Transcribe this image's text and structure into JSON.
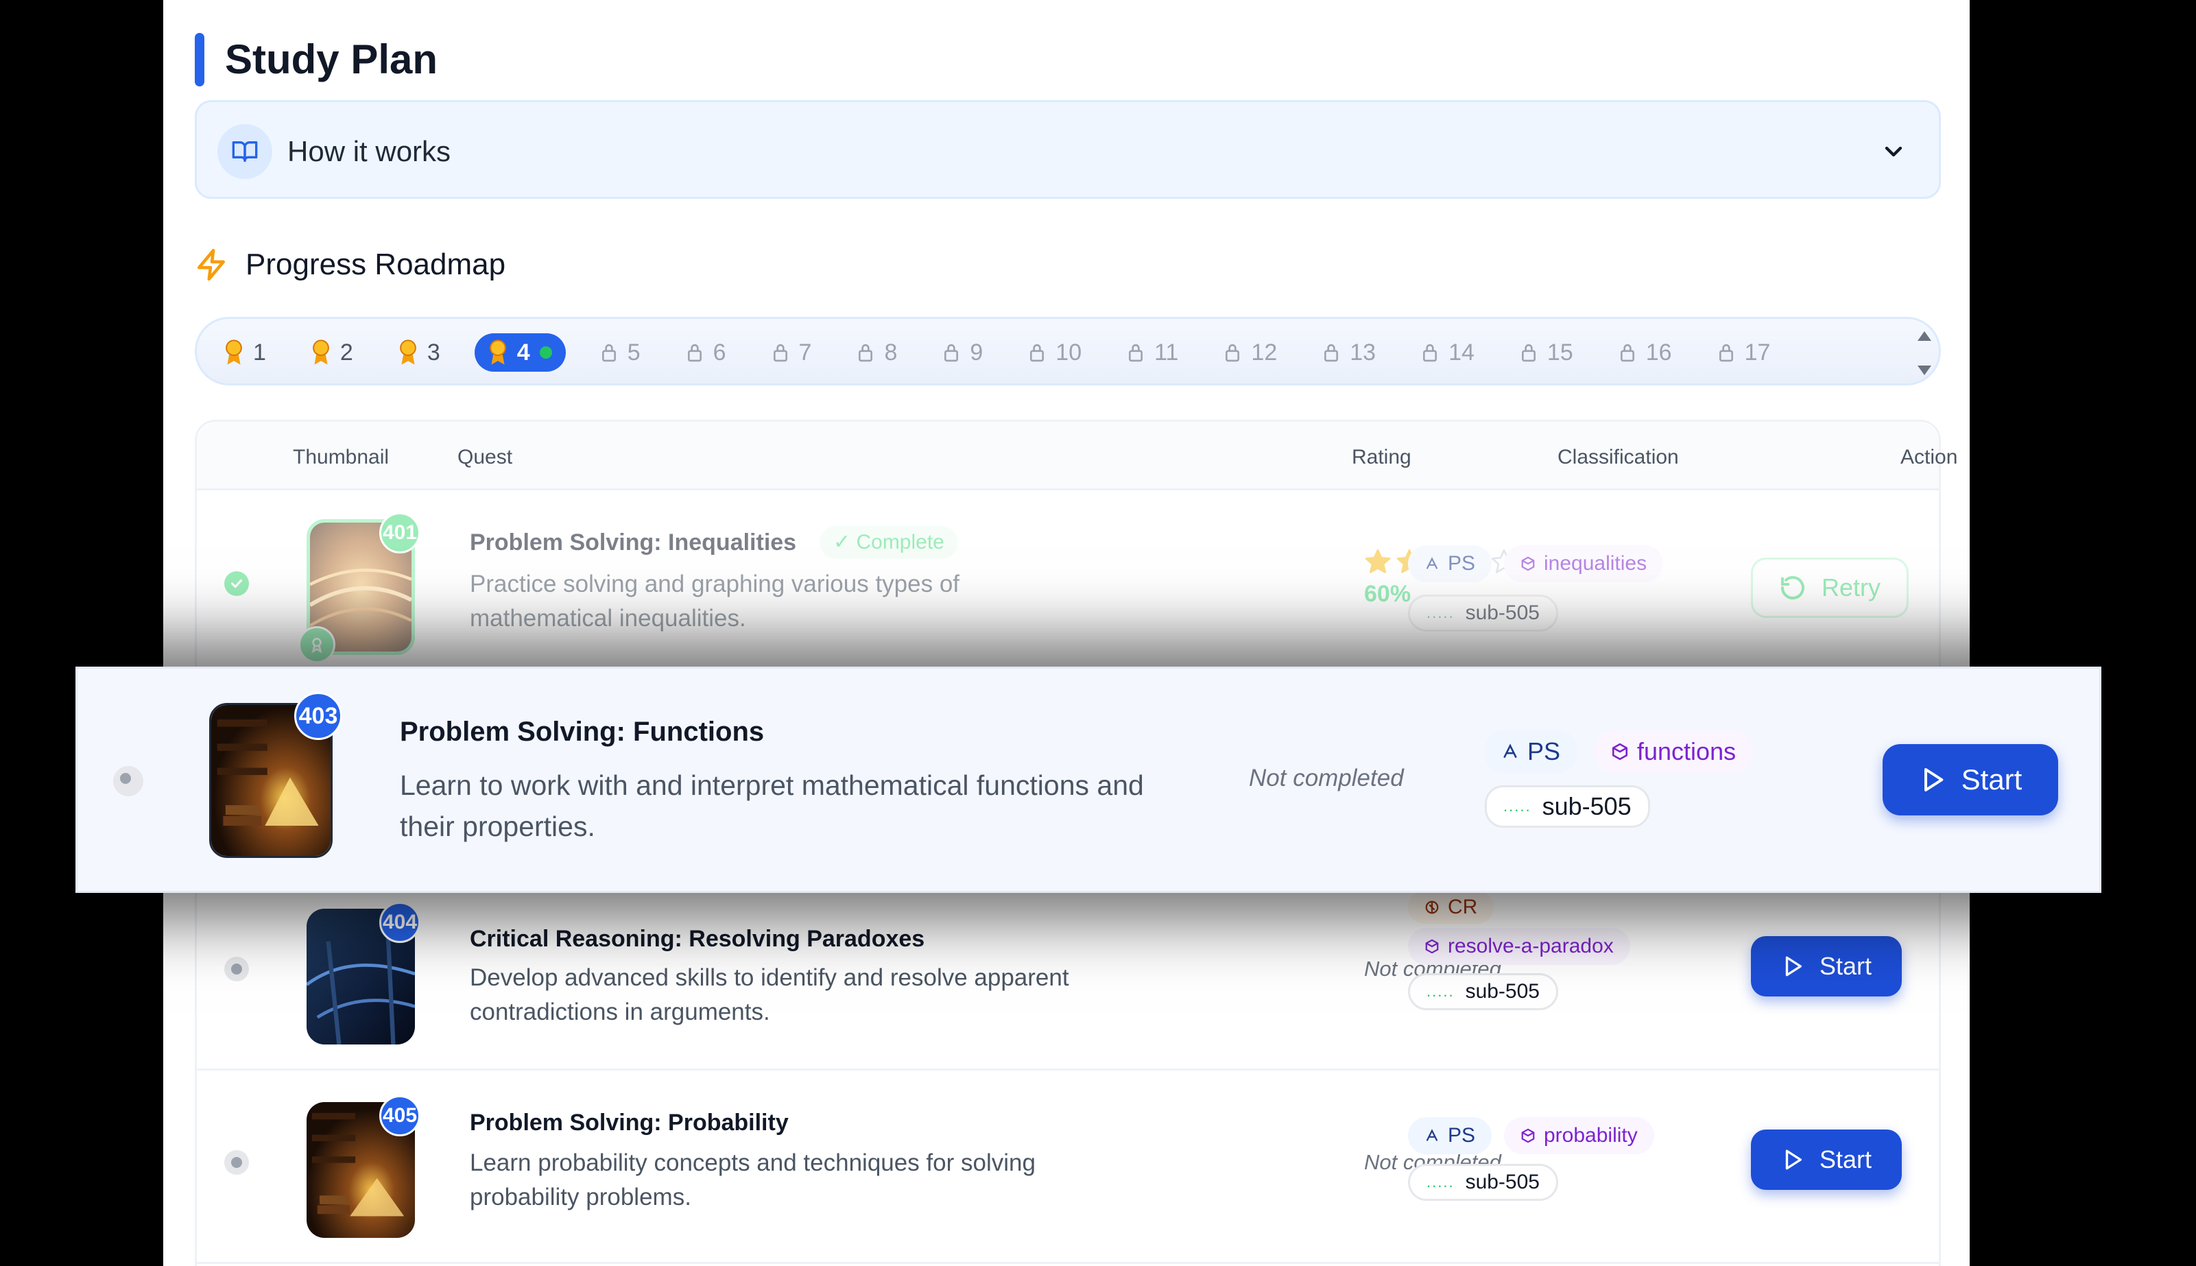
{
  "page": {
    "title": "Study Plan"
  },
  "how_it_works": {
    "label": "How it works",
    "icon": "book-open-icon"
  },
  "roadmap": {
    "heading": "Progress Roadmap",
    "steps": [
      {
        "label": "1",
        "state": "completed"
      },
      {
        "label": "2",
        "state": "completed"
      },
      {
        "label": "3",
        "state": "completed"
      },
      {
        "label": "4",
        "state": "current"
      },
      {
        "label": "5",
        "state": "locked"
      },
      {
        "label": "6",
        "state": "locked"
      },
      {
        "label": "7",
        "state": "locked"
      },
      {
        "label": "8",
        "state": "locked"
      },
      {
        "label": "9",
        "state": "locked"
      },
      {
        "label": "10",
        "state": "locked"
      },
      {
        "label": "11",
        "state": "locked"
      },
      {
        "label": "12",
        "state": "locked"
      },
      {
        "label": "13",
        "state": "locked"
      },
      {
        "label": "14",
        "state": "locked"
      },
      {
        "label": "15",
        "state": "locked"
      },
      {
        "label": "16",
        "state": "locked"
      },
      {
        "label": "17",
        "state": "locked"
      }
    ]
  },
  "table": {
    "headers": {
      "thumbnail": "Thumbnail",
      "quest": "Quest",
      "rating": "Rating",
      "classification": "Classification",
      "action": "Action"
    },
    "rows": [
      {
        "number": "401",
        "title": "Problem Solving: Inequalities",
        "status_badge": "✓ Complete",
        "description": "Practice solving and graphing various types of mathematical inequalities.",
        "rating_stars": 2,
        "rating_max": 5,
        "rating_text": "60%",
        "tags": {
          "type": "PS",
          "topic": "inequalities",
          "sub": "sub-505",
          "sub_dots": "....."
        },
        "action": "Retry"
      },
      {
        "number": "403",
        "title": "Problem Solving: Functions",
        "description": "Learn to work with and interpret mathematical functions and their properties.",
        "rating_text": "Not completed",
        "tags": {
          "type": "PS",
          "topic": "functions",
          "sub": "sub-505",
          "sub_dots": "....."
        },
        "action": "Start"
      },
      {
        "number": "404",
        "title": "Critical Reasoning: Resolving Paradoxes",
        "description": "Develop advanced skills to identify and resolve apparent contradictions in arguments.",
        "rating_text": "Not completed",
        "tags": {
          "type": "CR",
          "topic": "resolve-a-paradox",
          "sub": "sub-505",
          "sub_dots": "....."
        },
        "action": "Start"
      },
      {
        "number": "405",
        "title": "Problem Solving: Probability",
        "description": "Learn probability concepts and techniques for solving probability problems.",
        "rating_text": "Not completed",
        "tags": {
          "type": "PS",
          "topic": "probability",
          "sub": "sub-505",
          "sub_dots": "....."
        },
        "action": "Start"
      }
    ]
  },
  "colors": {
    "accent": "#2563eb",
    "success": "#4ade80",
    "topic": "#7e22ce",
    "critical": "#9a3412"
  }
}
